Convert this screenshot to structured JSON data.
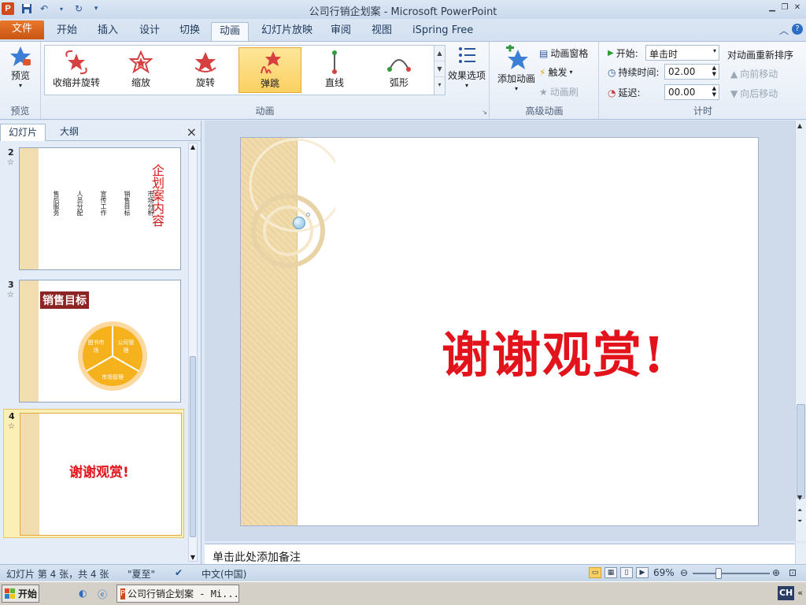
{
  "window": {
    "title": "公司行销企划案 - Microsoft PowerPoint",
    "app_letter": "P"
  },
  "ribbon_tabs": [
    "文件",
    "开始",
    "插入",
    "设计",
    "切换",
    "动画",
    "幻灯片放映",
    "审阅",
    "视图",
    "iSpring Free"
  ],
  "active_tab": "动画",
  "preview_group": {
    "button": "预览",
    "label": "预览"
  },
  "animation_group": {
    "label": "动画",
    "items": [
      "收缩并旋转",
      "缩放",
      "旋转",
      "弹跳",
      "直线",
      "弧形"
    ],
    "selected": "弹跳",
    "effect_options": "效果选项"
  },
  "advanced_group": {
    "label": "高级动画",
    "add_animation": "添加动画",
    "animation_pane": "动画窗格",
    "trigger": "触发",
    "painter": "动画刷"
  },
  "timing_group": {
    "label": "计时",
    "start_label": "开始:",
    "start_value": "单击时",
    "duration_label": "持续时间:",
    "duration_value": "02.00",
    "delay_label": "延迟:",
    "delay_value": "00.00",
    "reorder_title": "对动画重新排序",
    "move_earlier": "向前移动",
    "move_later": "向后移动"
  },
  "left_panel": {
    "tab_slides": "幻灯片",
    "tab_outline": "大纲",
    "close": "×",
    "slides": [
      {
        "num": "2",
        "title": "企划案内容",
        "bullets": [
          "售后服务",
          "人员分配",
          "宣传工作",
          "销售目标",
          "市场分析"
        ]
      },
      {
        "num": "3",
        "title": "销售目标",
        "segments": [
          "图书市场",
          "公司管理",
          "市场管理"
        ]
      },
      {
        "num": "4",
        "title": "谢谢观赏!"
      }
    ]
  },
  "slide": {
    "title": "谢谢观赏!"
  },
  "notes": {
    "placeholder": "单击此处添加备注"
  },
  "status": {
    "slide_info": "幻灯片 第 4 张，共 4 张",
    "theme": "\"夏至\"",
    "language": "中文(中国)",
    "zoom": "69%"
  },
  "taskbar": {
    "start": "开始",
    "task": "公司行销企划案 - Mi...",
    "ime": "CH"
  },
  "colors": {
    "accent_file": "#c95514",
    "selection": "#fbd061",
    "slide_title_red": "#e3131b"
  }
}
